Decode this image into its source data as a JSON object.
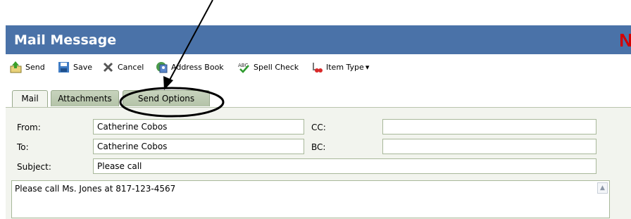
{
  "window": {
    "title": "Mail Message",
    "brand_letter": "N"
  },
  "toolbar": {
    "send": "Send",
    "save": "Save",
    "cancel": "Cancel",
    "address_book": "Address Book",
    "spell_check": "Spell Check",
    "item_type": "Item Type",
    "item_type_arrow": "▾"
  },
  "tabs": {
    "mail": "Mail",
    "attachments": "Attachments",
    "send_options": "Send Options"
  },
  "form": {
    "from_label": "From:",
    "from_value": "Catherine Cobos",
    "to_label": "To:",
    "to_value": "Catherine Cobos",
    "cc_label": "CC:",
    "cc_value": "",
    "bc_label": "BC:",
    "bc_value": "",
    "subject_label": "Subject:",
    "subject_value": "Please call",
    "body": "Please call Ms. Jones at 817-123-4567"
  },
  "icons": {
    "send": "send-icon",
    "save": "save-icon",
    "cancel": "cancel-icon",
    "address_book": "address-book-icon",
    "spell_check": "spell-check-icon",
    "item_type": "item-type-icon",
    "scroll_up": "▲"
  },
  "colors": {
    "title_bar": "#4a72a8",
    "brand": "#d40000",
    "tab": "#b4c3a8",
    "panel": "#f2f4ee"
  }
}
